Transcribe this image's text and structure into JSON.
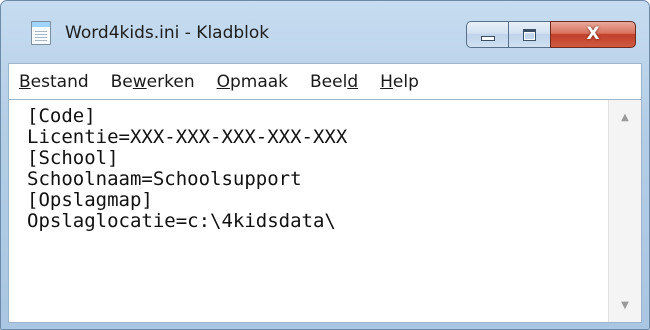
{
  "window": {
    "title": "Word4kids.ini - Kladblok",
    "minimize_icon": "minimize-icon",
    "maximize_icon": "maximize-icon",
    "close_glyph": "X",
    "app_icon": "notepad-icon"
  },
  "menu": [
    {
      "mnemonic": "B",
      "rest": "estand"
    },
    {
      "pre": "Be",
      "mnemonic": "w",
      "rest": "erken"
    },
    {
      "mnemonic": "O",
      "rest": "pmaak"
    },
    {
      "pre": "Beel",
      "mnemonic": "d",
      "rest": ""
    },
    {
      "mnemonic": "H",
      "rest": "elp"
    }
  ],
  "document": {
    "lines": [
      "[Code]",
      "Licentie=XXX-XXX-XXX-XXX-XXX",
      "[School]",
      "Schoolnaam=Schoolsupport",
      "[Opslagmap]",
      "Opslaglocatie=c:\\4kidsdata\\"
    ]
  },
  "scrollbar": {
    "up_glyph": "▲",
    "down_glyph": "▼"
  },
  "colors": {
    "frame": "#b3cde6",
    "close_button": "#c1402b"
  }
}
